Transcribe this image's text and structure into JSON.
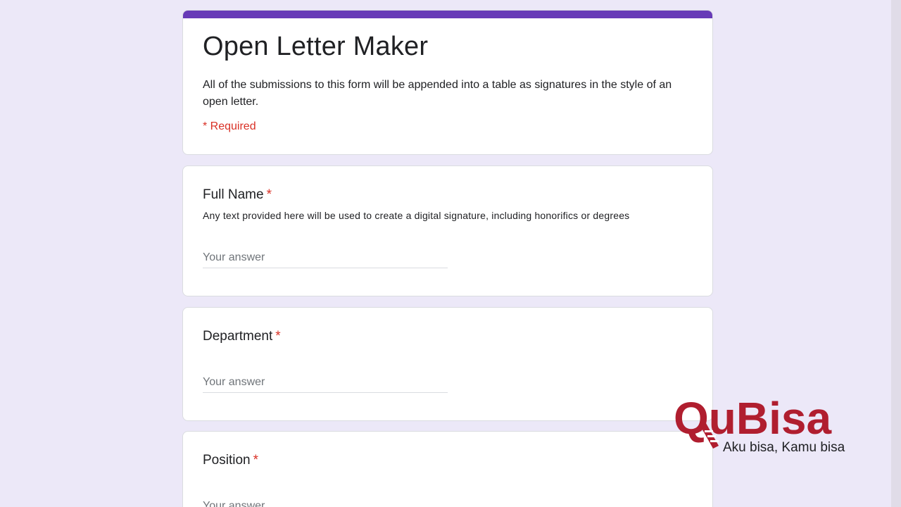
{
  "form": {
    "title": "Open Letter Maker",
    "description": "All of the submissions to this form will be appended into a table as signatures in the style of an open letter.",
    "required_note": "* Required",
    "accent_color": "#673ab7",
    "required_color": "#d93025"
  },
  "questions": [
    {
      "label": "Full Name",
      "required_mark": "*",
      "help": "Any text provided here will be used to create a digital signature, including honorifics or degrees",
      "placeholder": "Your answer"
    },
    {
      "label": "Department",
      "required_mark": "*",
      "placeholder": "Your answer"
    },
    {
      "label": "Position",
      "required_mark": "*",
      "placeholder": "Your answer"
    }
  ],
  "watermark": {
    "brand": "QuBisa",
    "tagline": "Aku bisa, Kamu bisa",
    "color": "#b01e2f"
  }
}
